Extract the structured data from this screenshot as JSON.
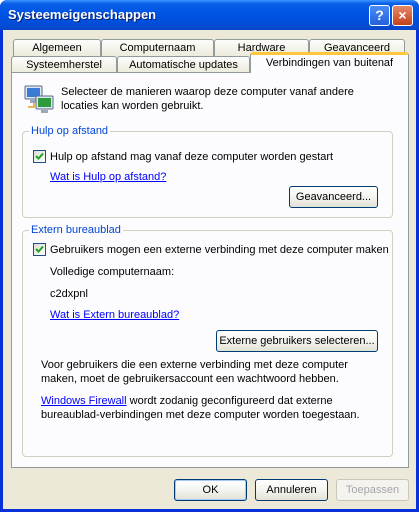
{
  "window": {
    "title": "Systeemeigenschappen",
    "help_glyph": "?",
    "close_glyph": "×"
  },
  "tabs": {
    "row1": [
      "Algemeen",
      "Computernaam",
      "Hardware",
      "Geavanceerd"
    ],
    "row2": [
      "Systeemherstel",
      "Automatische updates",
      "Verbindingen van buitenaf"
    ],
    "active": "Verbindingen van buitenaf"
  },
  "intro": {
    "text": "Selecteer de manieren waarop deze computer vanaf andere locaties kan worden gebruikt.",
    "icon": "computer-network-icon"
  },
  "remote_assistance": {
    "group_title": "Hulp op afstand",
    "checkbox_label": "Hulp op afstand mag vanaf deze computer worden gestart",
    "checked": true,
    "help_link": "Wat is Hulp op afstand?",
    "advanced_button": "Geavanceerd..."
  },
  "remote_desktop": {
    "group_title": "Extern bureaublad",
    "checkbox_label": "Gebruikers mogen een externe verbinding met deze computer maken",
    "checked": true,
    "computer_name_label": "Volledige computernaam:",
    "computer_name": "c2dxpnl",
    "help_link": "Wat is Extern bureaublad?",
    "select_users_button": "Externe gebruikers selecteren...",
    "password_note": "Voor gebruikers die een externe verbinding met deze computer maken, moet de gebruikersaccount een wachtwoord hebben.",
    "firewall_link": "Windows Firewall",
    "firewall_note": " wordt zodanig geconfigureerd dat externe bureaublad-verbindingen met deze computer worden toegestaan."
  },
  "footer": {
    "ok": "OK",
    "cancel": "Annuleren",
    "apply": "Toepassen"
  },
  "colors": {
    "titlebar": "#0055e5",
    "dialog_face": "#ece9d8",
    "group_title": "#0046d5",
    "link": "#0000ff",
    "active_tab_accent": "#ffc83c"
  }
}
